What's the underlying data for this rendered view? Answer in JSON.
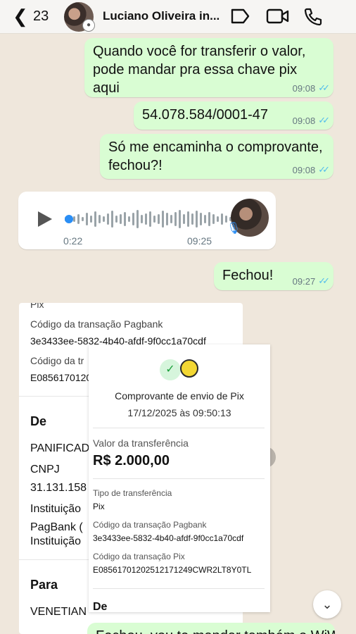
{
  "header": {
    "back_count": "23",
    "contact_name": "Luciano Oliveira in..."
  },
  "messages": [
    {
      "text": "Quando você for transferir o valor, pode mandar pra essa chave pix aqui",
      "time": "09:08"
    },
    {
      "text": "54.078.584/0001-47",
      "time": "09:08"
    },
    {
      "text": "Só me encaminha o comprovante, fechou?!",
      "time": "09:08"
    },
    {
      "audio_elapsed": "0:22",
      "time": "09:25"
    },
    {
      "text": "Fechou!",
      "time": "09:27"
    }
  ],
  "receipt_back": {
    "pix_label": "Pix",
    "pagbank_code_label": "Código da transação Pagbank",
    "pagbank_code": "3e3433ee-5832-4b40-afdf-9f0cc1a70cdf",
    "pix_code_label": "Código da tr",
    "pix_code": "E0856170120",
    "de_label": "De",
    "de_name": "PANIFICAD",
    "cnpj_label": "CNPJ",
    "cnpj_value": "31.131.158",
    "instituicao_label": "Instituição",
    "instituicao_value_1": "PagBank (",
    "instituicao_value_2": "Instituição",
    "para_label": "Para",
    "para_name": "VENETIAN"
  },
  "receipt_front": {
    "title": "Comprovante de envio de Pix",
    "datetime": "17/12/2025 às 09:50:13",
    "valor_label": "Valor da transferência",
    "valor": "R$ 2.000,00",
    "tipo_label": "Tipo de transferência",
    "tipo": "Pix",
    "pagbank_code_label": "Código da transação Pagbank",
    "pagbank_code": "3e3433ee-5832-4b40-afdf-9f0cc1a70cdf",
    "pix_code_label": "Código da transação Pix",
    "pix_code": "E08561701202512171249CWR2LT8Y0TL",
    "de_label": "De"
  },
  "partial_message": "Fechou, vou te mandar também o WiWilli",
  "colors": {
    "outgoing_bubble": "#d9fdd3",
    "incoming_bubble": "#ffffff",
    "chat_background": "#efe7dc",
    "read_ticks": "#53bdeb"
  }
}
